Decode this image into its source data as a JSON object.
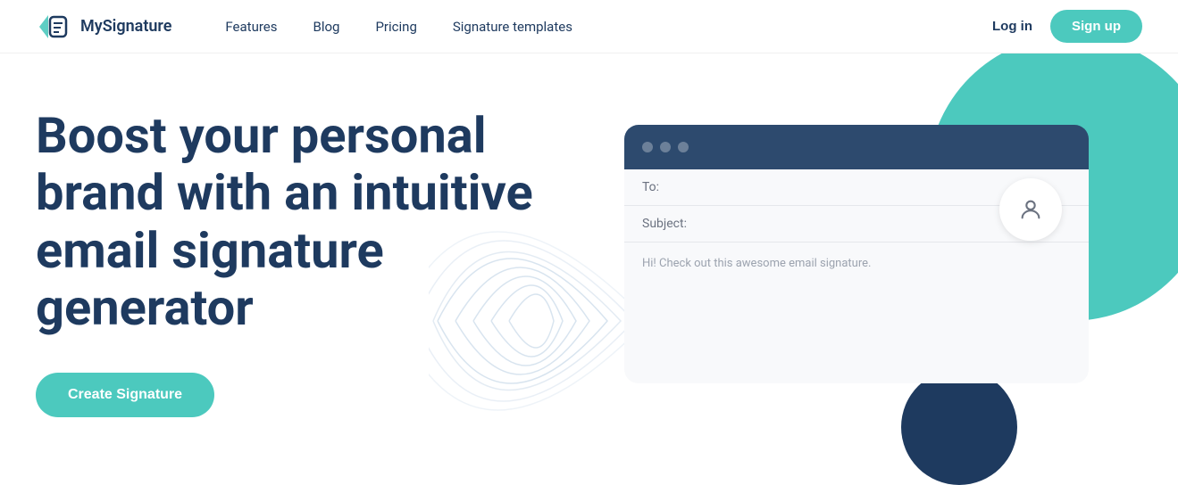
{
  "navbar": {
    "logo_text": "MySignature",
    "nav_links": [
      {
        "label": "Features",
        "id": "features"
      },
      {
        "label": "Blog",
        "id": "blog"
      },
      {
        "label": "Pricing",
        "id": "pricing"
      },
      {
        "label": "Signature templates",
        "id": "signature-templates"
      }
    ],
    "login_label": "Log in",
    "signup_label": "Sign up"
  },
  "hero": {
    "headline_line1": "Boost your personal",
    "headline_line2": "brand with an intuitive",
    "headline_line3": "email signature",
    "headline_line4": "generator",
    "cta_label": "Create Signature",
    "email_mockup": {
      "to_label": "To:",
      "subject_label": "Subject:",
      "body_text": "Hi! Check out this awesome email signature."
    }
  }
}
